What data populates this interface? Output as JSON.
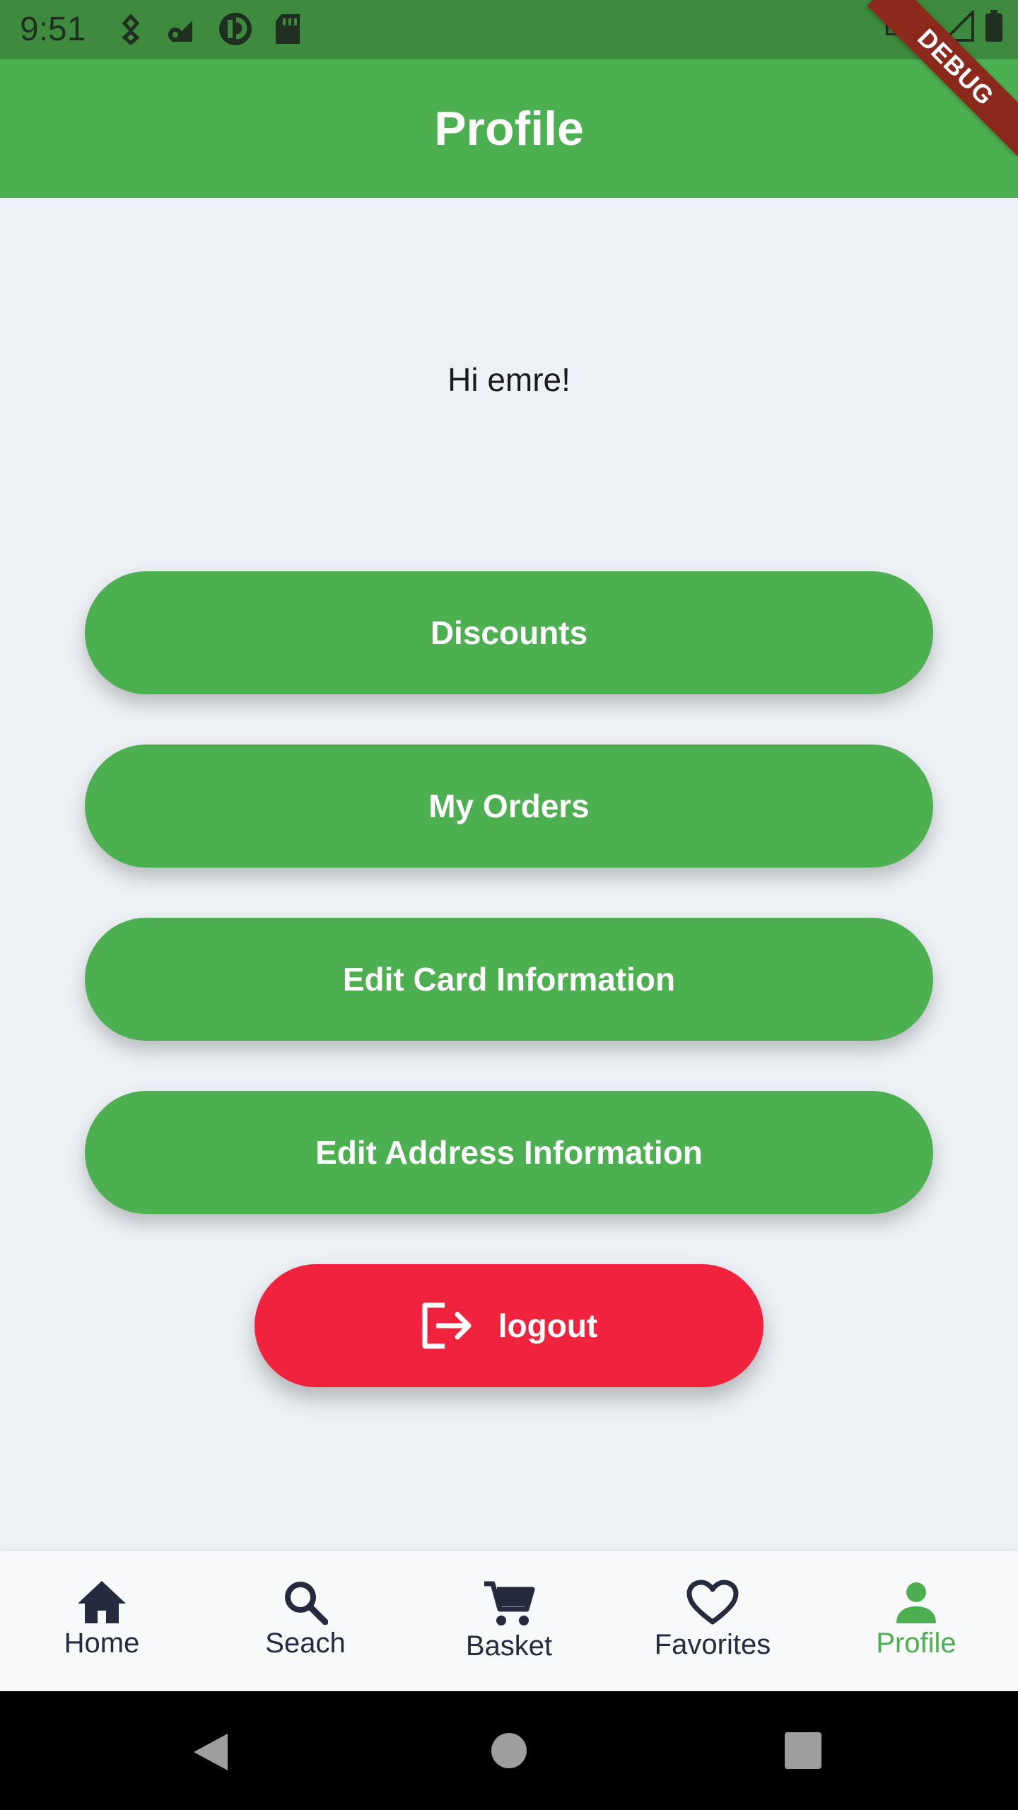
{
  "status_bar": {
    "time": "9:51",
    "network": "LTE",
    "icons": [
      "location-pin-icon",
      "settings-wifi-icon",
      "app-notification-icon",
      "sd-card-icon",
      "signal-icon",
      "battery-icon"
    ]
  },
  "app_bar": {
    "title": "Profile"
  },
  "debug_banner": "DEBUG",
  "greeting": "Hi emre!",
  "menu": {
    "discounts": "Discounts",
    "my_orders": "My Orders",
    "edit_card": "Edit Card Information",
    "edit_address": "Edit Address Information",
    "logout": "logout"
  },
  "bottom_nav": {
    "items": [
      {
        "label": "Home",
        "icon": "home-icon"
      },
      {
        "label": "Seach",
        "icon": "search-icon"
      },
      {
        "label": "Basket",
        "icon": "cart-icon"
      },
      {
        "label": "Favorites",
        "icon": "heart-icon"
      },
      {
        "label": "Profile",
        "icon": "person-icon"
      }
    ],
    "active": "Profile"
  },
  "colors": {
    "primary": "#4caf50",
    "logout": "#f0223e",
    "background": "#edf1f5",
    "nav_icon": "#262a3f"
  },
  "system_nav": [
    "back-icon",
    "home-circle-icon",
    "recents-icon"
  ]
}
